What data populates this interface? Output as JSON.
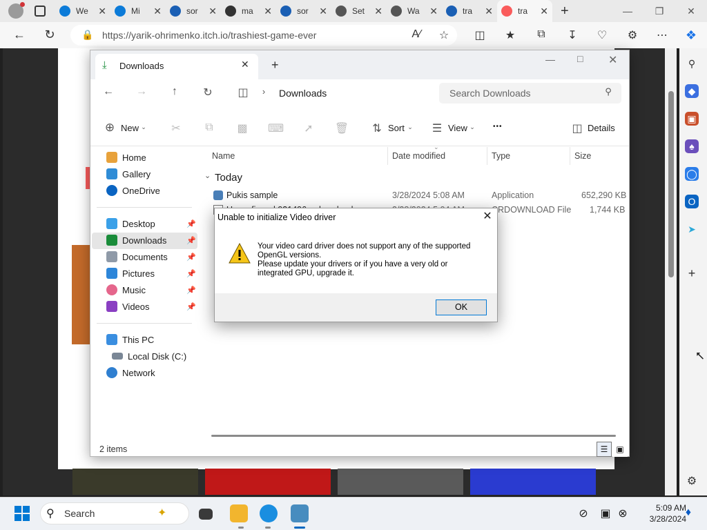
{
  "browser": {
    "tabs": [
      {
        "title": "We",
        "icon": "edge-icon",
        "color": "#0c7bd8"
      },
      {
        "title": "Mi",
        "icon": "edge-icon",
        "color": "#0c7bd8"
      },
      {
        "title": "sor",
        "icon": "search-icon",
        "color": "#1a5fb4"
      },
      {
        "title": "ma",
        "icon": "library-icon",
        "color": "#333333"
      },
      {
        "title": "sor",
        "icon": "search-icon",
        "color": "#1a5fb4"
      },
      {
        "title": "Set",
        "icon": "gear-icon",
        "color": "#555555"
      },
      {
        "title": "Wa",
        "icon": "briefcase-icon",
        "color": "#555555"
      },
      {
        "title": "tra",
        "icon": "search-icon",
        "color": "#1a5fb4"
      },
      {
        "title": "tra",
        "icon": "itch-icon",
        "color": "#fa5c5c",
        "active": true
      }
    ],
    "url": "https://yarik-ohrimenko.itch.io/trashiest-game-ever"
  },
  "explorer": {
    "tab_title": "Downloads",
    "breadcrumb": "Downloads",
    "search_placeholder": "Search Downloads",
    "toolbar": {
      "new_label": "New",
      "sort_label": "Sort",
      "view_label": "View",
      "more_label": "•••",
      "details_label": "Details"
    },
    "nav": {
      "home": "Home",
      "gallery": "Gallery",
      "onedrive": "OneDrive",
      "desktop": "Desktop",
      "downloads": "Downloads",
      "documents": "Documents",
      "pictures": "Pictures",
      "music": "Music",
      "videos": "Videos",
      "thispc": "This PC",
      "localdisk": "Local Disk (C:)",
      "network": "Network"
    },
    "columns": {
      "name": "Name",
      "date": "Date modified",
      "type": "Type",
      "size": "Size"
    },
    "group": "Today",
    "files": [
      {
        "name": "Pukis sample",
        "date": "3/28/2024 5:08 AM",
        "type": "Application",
        "size": "652,290 KB"
      },
      {
        "name": "Unconfirmed 931496.crdownload",
        "date": "3/28/2024 5:04 AM",
        "type": "CRDOWNLOAD File",
        "size": "1,744 KB"
      }
    ],
    "status": "2 items"
  },
  "dialog": {
    "title": "Unable to initialize Video driver",
    "message": "Your video card driver does not support any of the supported\nOpenGL versions.\nPlease update your drivers or if you have a very old or\nintegrated GPU, upgrade it.",
    "ok": "OK"
  },
  "taskbar": {
    "search": "Search",
    "time": "5:09 AM",
    "date": "3/28/2024"
  },
  "colors": {
    "accent": "#0067c0",
    "warning": "#f5c518"
  }
}
